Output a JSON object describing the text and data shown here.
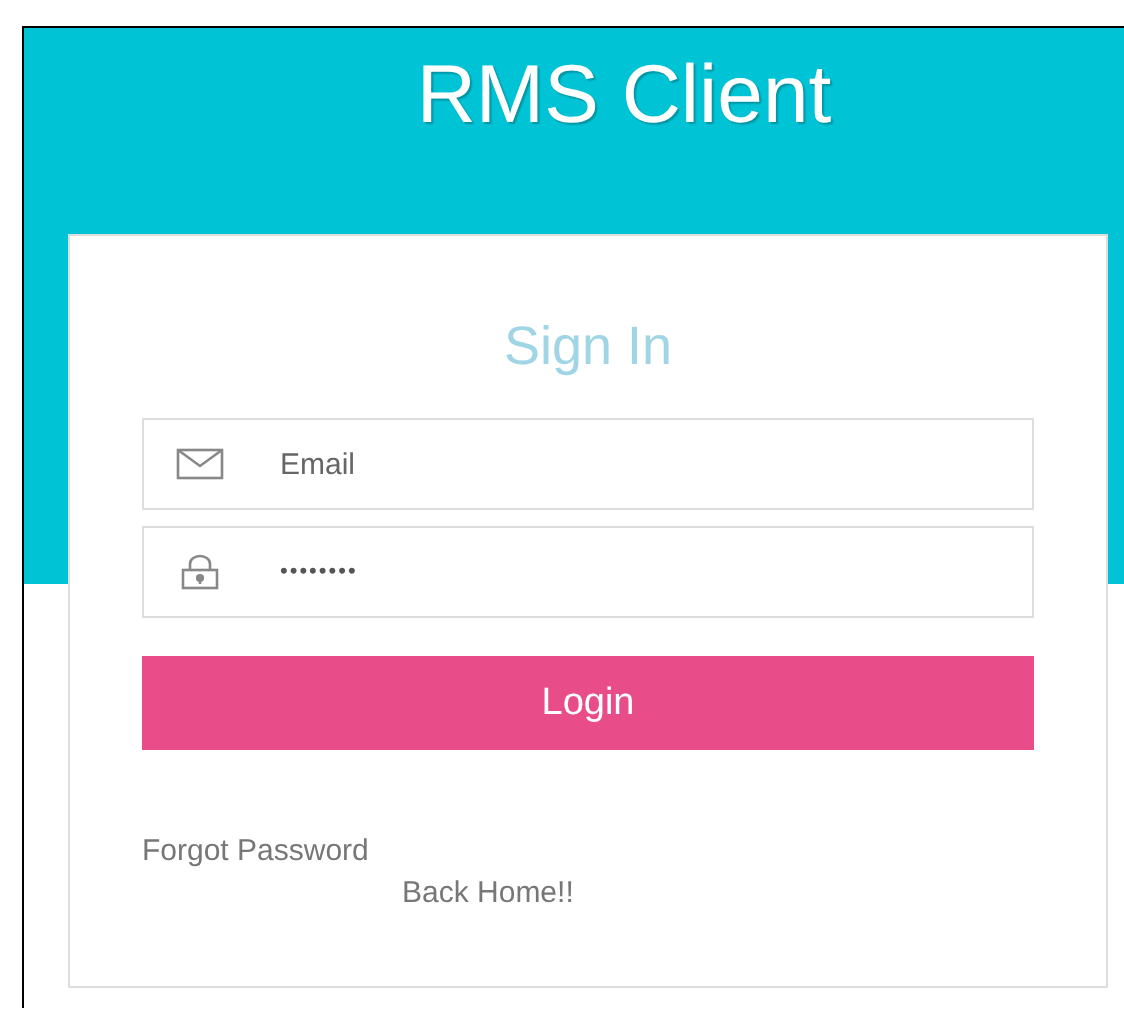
{
  "header": {
    "title": "RMS Client"
  },
  "form": {
    "heading": "Sign In",
    "fields": [
      {
        "kind": "email",
        "placeholder": "Email"
      },
      {
        "kind": "password",
        "value": "••••••••"
      }
    ],
    "submit": "Login",
    "links": [
      "Forgot Password",
      "Back Home!!"
    ]
  }
}
